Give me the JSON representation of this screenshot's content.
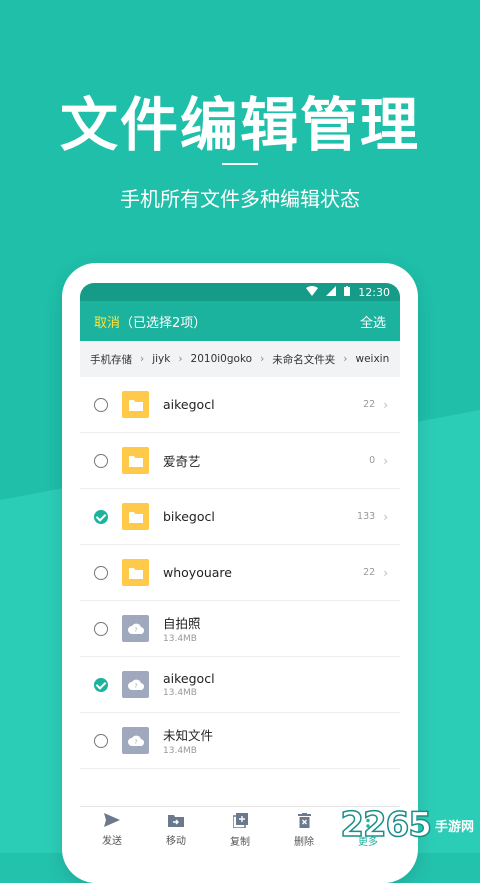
{
  "promo": {
    "headline": "文件编辑管理",
    "subline": "手机所有文件多种编辑状态"
  },
  "status_bar": {
    "time": "12:30"
  },
  "action_bar": {
    "cancel": "取消",
    "selection_text": "（已选择2项）",
    "select_all": "全选"
  },
  "breadcrumb": [
    "手机存储",
    "›",
    "jiyk",
    "›",
    "2010i0goko",
    "›",
    "未命名文件夹",
    "›",
    "weixin"
  ],
  "files": [
    {
      "name": "aikegocl",
      "type": "folder",
      "count": "22",
      "checked": false
    },
    {
      "name": "爱奇艺",
      "type": "folder",
      "count": "0",
      "checked": false
    },
    {
      "name": "bikegocl",
      "type": "folder",
      "count": "133",
      "checked": true
    },
    {
      "name": "whoyouare",
      "type": "folder",
      "count": "22",
      "checked": false
    },
    {
      "name": "自拍照",
      "type": "unknown",
      "size": "13.4MB",
      "checked": false
    },
    {
      "name": "aikegocl",
      "type": "unknown",
      "size": "13.4MB",
      "checked": true
    },
    {
      "name": "未知文件",
      "type": "unknown",
      "size": "13.4MB",
      "checked": false
    }
  ],
  "toolbar": [
    {
      "label": "发送",
      "icon": "send-icon"
    },
    {
      "label": "移动",
      "icon": "move-icon"
    },
    {
      "label": "复制",
      "icon": "copy-icon"
    },
    {
      "label": "删除",
      "icon": "delete-icon"
    },
    {
      "label": "更多",
      "icon": "more-icon"
    }
  ],
  "watermark": {
    "number": "2265",
    "site": "手游网"
  },
  "colors": {
    "brand": "#1bb39e",
    "background": "#23c2ad",
    "folder": "#ffc94a"
  }
}
